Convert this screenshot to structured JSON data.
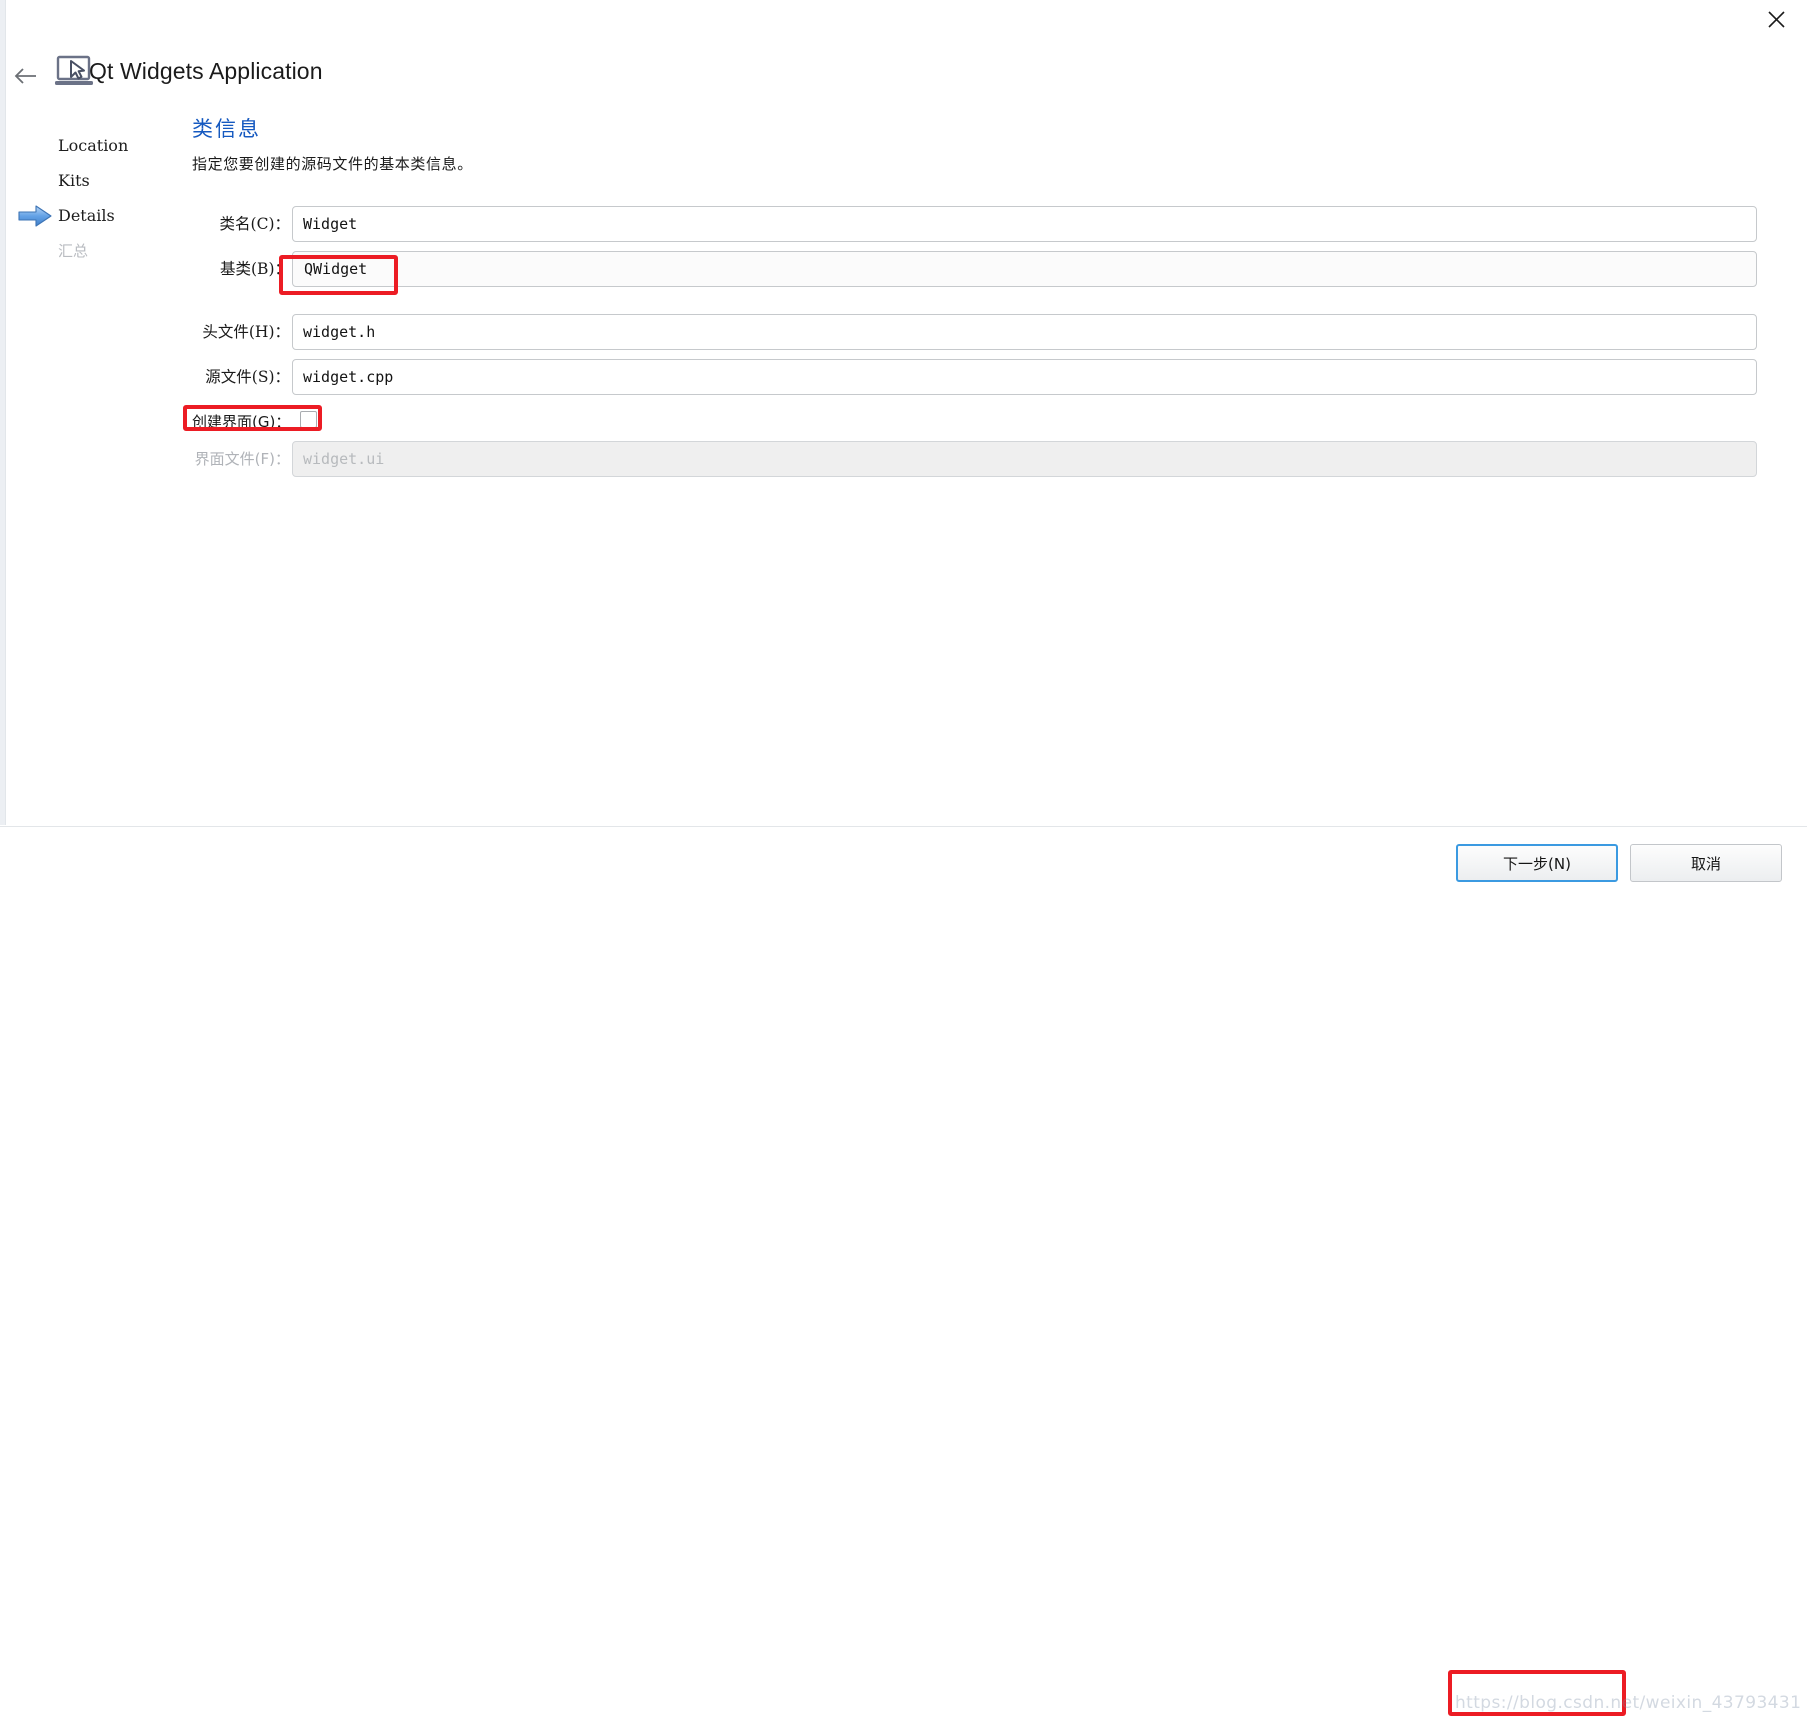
{
  "window": {
    "title": "Qt Widgets Application",
    "close_label": "×",
    "back_label": "←"
  },
  "steps": [
    {
      "label": "Location",
      "state": "done"
    },
    {
      "label": "Kits",
      "state": "done"
    },
    {
      "label": "Details",
      "state": "current"
    },
    {
      "label": "汇总",
      "state": "upcoming"
    }
  ],
  "page": {
    "heading": "类信息",
    "subtitle": "指定您要创建的源码文件的基本类信息。"
  },
  "form": {
    "class_name": {
      "label": "类名(C)：",
      "value": "Widget"
    },
    "base_class": {
      "label": "基类(B)：",
      "value": "QWidget"
    },
    "header_file": {
      "label": "头文件(H)：",
      "value": "widget.h"
    },
    "source_file": {
      "label": "源文件(S)：",
      "value": "widget.cpp"
    },
    "create_ui": {
      "label": "创建界面(G)：",
      "checked": false
    },
    "ui_file": {
      "label": "界面文件(F)：",
      "value": "widget.ui",
      "disabled": true
    }
  },
  "footer": {
    "next_label": "下一步(N)",
    "cancel_label": "取消",
    "watermark": "https://blog.csdn.net/weixin_43793431"
  },
  "colors": {
    "heading_blue": "#1559c0",
    "annotation_red": "#ec1c24",
    "focus_blue": "#3b9ae1",
    "step_arrow_blue": "#4d92e0"
  }
}
